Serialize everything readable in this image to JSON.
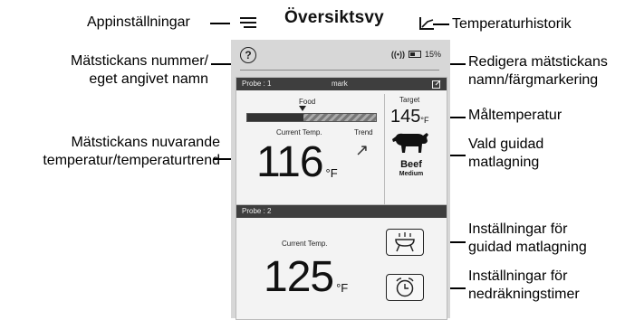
{
  "header": {
    "title": "Översiktsvy"
  },
  "callouts": {
    "app_settings": "Appinställningar",
    "temp_history": "Temperaturhistorik",
    "probe_name_1": "Mätstickans nummer/",
    "probe_name_2": "eget angivet namn",
    "edit_1": "Redigera mätstickans",
    "edit_2": "namn/färgmarkering",
    "target_temp": "Måltemperatur",
    "current_1": "Mätstickans nuvarande",
    "current_2": "temperatur/temperaturtrend",
    "guided_1": "Vald guidad",
    "guided_2": "matlagning",
    "guided_settings_1": "Inställningar för",
    "guided_settings_2": "guidad matlagning",
    "timer_settings_1": "Inställningar för",
    "timer_settings_2": "nedräkningstimer"
  },
  "status_bar": {
    "help": "?",
    "signal": "((•))",
    "battery": "15%"
  },
  "probe1": {
    "header_label": "Probe : 1",
    "name": "mark",
    "food_label": "Food",
    "food_progress": 0.44,
    "current_label": "Current Temp.",
    "current_temp": "116",
    "unit": "°F",
    "trend_label": "Trend",
    "trend_glyph": "↗",
    "target_label": "Target",
    "target_temp": "145",
    "meat": "Beef",
    "doneness": "Medium"
  },
  "probe2": {
    "header_label": "Probe : 2",
    "current_label": "Current Temp.",
    "current_temp": "125",
    "unit": "°F"
  },
  "icons": {
    "menu": "hamburger-icon",
    "history": "chart-icon",
    "edit": "edit-icon",
    "beef": "cow-icon",
    "grill": "grill-icon",
    "timer": "alarm-clock-icon"
  }
}
